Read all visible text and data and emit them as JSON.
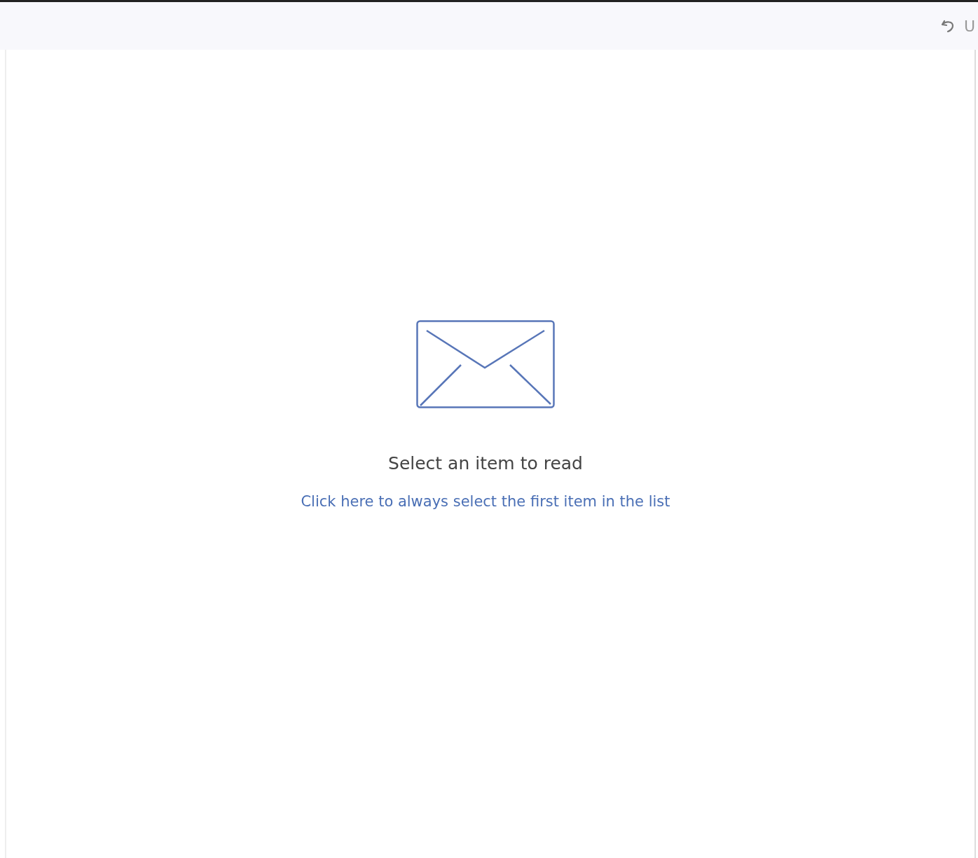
{
  "toolbar": {
    "undo_label": "U"
  },
  "reading_pane": {
    "message": "Select an item to read",
    "link": "Click here to always select the first item in the list"
  }
}
